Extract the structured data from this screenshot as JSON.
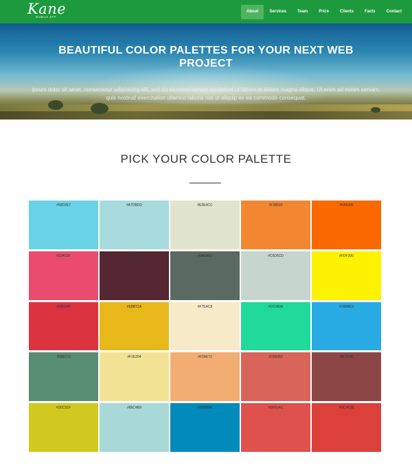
{
  "nav": {
    "logo_text": "Kane",
    "logo_sub": "MOBILE APP",
    "items": [
      {
        "label": "About",
        "active": true
      },
      {
        "label": "Services",
        "active": false
      },
      {
        "label": "Team",
        "active": false
      },
      {
        "label": "Price",
        "active": false
      },
      {
        "label": "Clients",
        "active": false
      },
      {
        "label": "Facts",
        "active": false
      },
      {
        "label": "Contact",
        "active": false
      }
    ]
  },
  "hero": {
    "title": "BEAUTIFUL COLOR PALETTES FOR YOUR NEXT WEB PROJECT",
    "text": "ipsum dolor sit amet, consectetur adipisicing elit, sed do eiusmod tempor incididunt ut labore et dolore magna aliqua. Ut enim ad minim veniam, quis nostrud exercitation ullamco laboris nisi ut aliquip ex ea commodo consequat."
  },
  "section": {
    "title": "PICK YOUR COLOR PALETTE"
  },
  "palette": [
    {
      "label": "#69D2E7",
      "color": "#69D2E7"
    },
    {
      "label": "#A7DBDD",
      "color": "#A7DBDD"
    },
    {
      "label": "#E0E4CC",
      "color": "#E0E4CC"
    },
    {
      "label": "#F38630",
      "color": "#F38630"
    },
    {
      "label": "#FA6900",
      "color": "#FA6900"
    },
    {
      "label": "#E94C6F",
      "color": "#E94C6F"
    },
    {
      "label": "#542733",
      "color": "#542733"
    },
    {
      "label": "#5A6A62",
      "color": "#5A6A62"
    },
    {
      "label": "#C6D5CD",
      "color": "#C6D5CD"
    },
    {
      "label": "#FDF200",
      "color": "#FDF200"
    },
    {
      "label": "#DB3340",
      "color": "#DB3340"
    },
    {
      "label": "#E8B71A",
      "color": "#E8B71A"
    },
    {
      "label": "#F7EAC8",
      "color": "#F7EAC8"
    },
    {
      "label": "#1FDA9A",
      "color": "#1FDA9A"
    },
    {
      "label": "#28ABE3",
      "color": "#28ABE3"
    },
    {
      "label": "#588C73",
      "color": "#588C73"
    },
    {
      "label": "#F2E394",
      "color": "#F2E394"
    },
    {
      "label": "#F2AE72",
      "color": "#F2AE72"
    },
    {
      "label": "#D96459",
      "color": "#D96459"
    },
    {
      "label": "#8C4646",
      "color": "#8C4646"
    },
    {
      "label": "#D0C91F",
      "color": "#D0C91F"
    },
    {
      "label": "#85C4B9",
      "color": "#A8D8D8"
    },
    {
      "label": "#008BBA",
      "color": "#008BBA"
    },
    {
      "label": "#DF514C",
      "color": "#DF514C"
    },
    {
      "label": "#DC403B",
      "color": "#DC403B"
    }
  ]
}
